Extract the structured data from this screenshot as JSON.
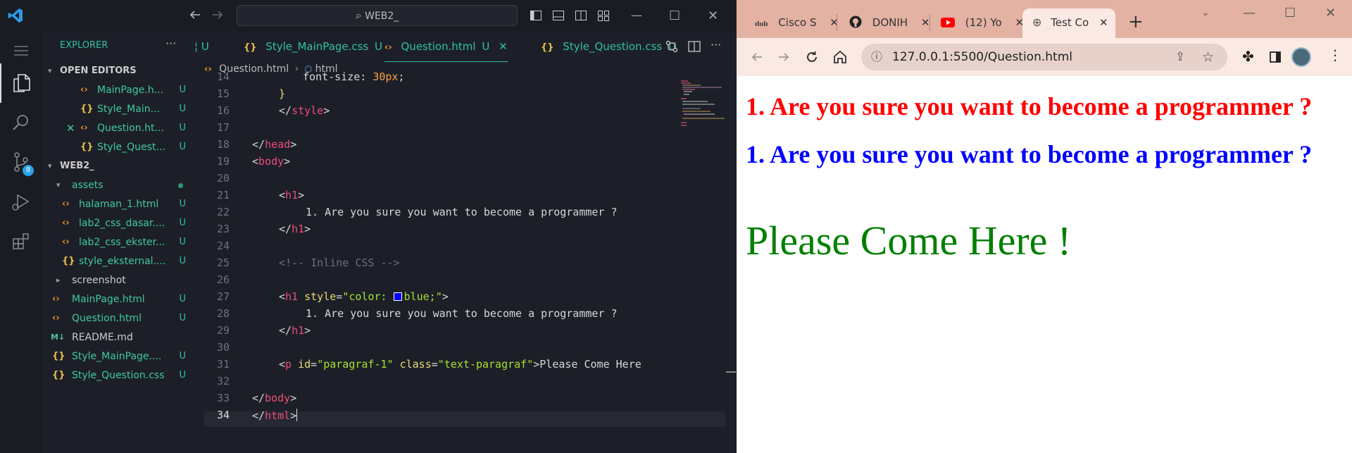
{
  "vscode": {
    "search_text": "WEB2_",
    "sidebar": {
      "header": "EXPLORER",
      "open_editors_title": "OPEN EDITORS",
      "open_editors": [
        {
          "name": "MainPage.h...",
          "status": "U"
        },
        {
          "name": "Style_Main...",
          "status": "U"
        },
        {
          "name": "Question.ht...",
          "status": "U"
        },
        {
          "name": "Style_Quest...",
          "status": "U"
        }
      ],
      "project_title": "WEB2_",
      "folder_assets": "assets",
      "assets_files": [
        {
          "name": "halaman_1.html",
          "status": "U"
        },
        {
          "name": "lab2_css_dasar....",
          "status": "U"
        },
        {
          "name": "lab2_css_ekster...",
          "status": "U"
        },
        {
          "name": "style_eksternal....",
          "status": "U"
        }
      ],
      "folder_screenshot": "screenshot",
      "root_files": [
        {
          "name": "MainPage.html",
          "status": "U"
        },
        {
          "name": "Question.html",
          "status": "U"
        },
        {
          "name": "README.md",
          "status": ""
        },
        {
          "name": "Style_MainPage....",
          "status": "U"
        },
        {
          "name": "Style_Question.css",
          "status": "U"
        }
      ],
      "scm_badge": "8"
    },
    "tabs": [
      {
        "label": "U"
      },
      {
        "label": "Style_MainPage.css",
        "status": "U"
      },
      {
        "label": "Question.html",
        "status": "U"
      },
      {
        "label": "Style_Question.css",
        "status": "U"
      }
    ],
    "breadcrumb": {
      "file": "Question.html",
      "node": "html"
    },
    "lines": [
      "14",
      "15",
      "16",
      "17",
      "18",
      "19",
      "20",
      "21",
      "22",
      "23",
      "24",
      "25",
      "26",
      "27",
      "28",
      "29",
      "30",
      "31",
      "32",
      "33",
      "34"
    ],
    "code": {
      "l14_prop": "font-size: ",
      "l14_val": "30px",
      "l15": "}",
      "l16_open": "</",
      "l16_tag": "style",
      "l16_close": ">",
      "l18_tag": "head",
      "l19_tag": "body",
      "l21_tag": "h1",
      "l22": "1. Are you sure you want to become a programmer ?",
      "l23_tag": "h1",
      "l25": "<!-- Inline CSS -->",
      "l27_tag": "h1",
      "l27_attr": "style",
      "l27_val1": "\"color: ",
      "l27_val2": "blue;\"",
      "l28": "1. Are you sure you want to become a programmer ?",
      "l29_tag": "h1",
      "l31_tag": "p",
      "l31_attr1": "id",
      "l31_val1": "\"paragraf-1\"",
      "l31_attr2": "class",
      "l31_val2": "\"text-paragraf\"",
      "l31_text": "Please Come Here",
      "l33_tag": "body",
      "l34_tag": "html"
    }
  },
  "browser": {
    "tabs": [
      {
        "label": "Cisco S"
      },
      {
        "label": "DONIH"
      },
      {
        "label": "(12) Yo"
      },
      {
        "label": "Test Co"
      }
    ],
    "url": "127.0.0.1:5500/Question.html",
    "page": {
      "h1_red": "1. Are you sure you want to become a programmer ?",
      "h1_blue": "1. Are you sure you want to become a programmer ?",
      "p_green": "Please Come Here !"
    },
    "colors": {
      "red": "#ff0000",
      "blue": "#0000ff",
      "green": "#008000"
    }
  }
}
